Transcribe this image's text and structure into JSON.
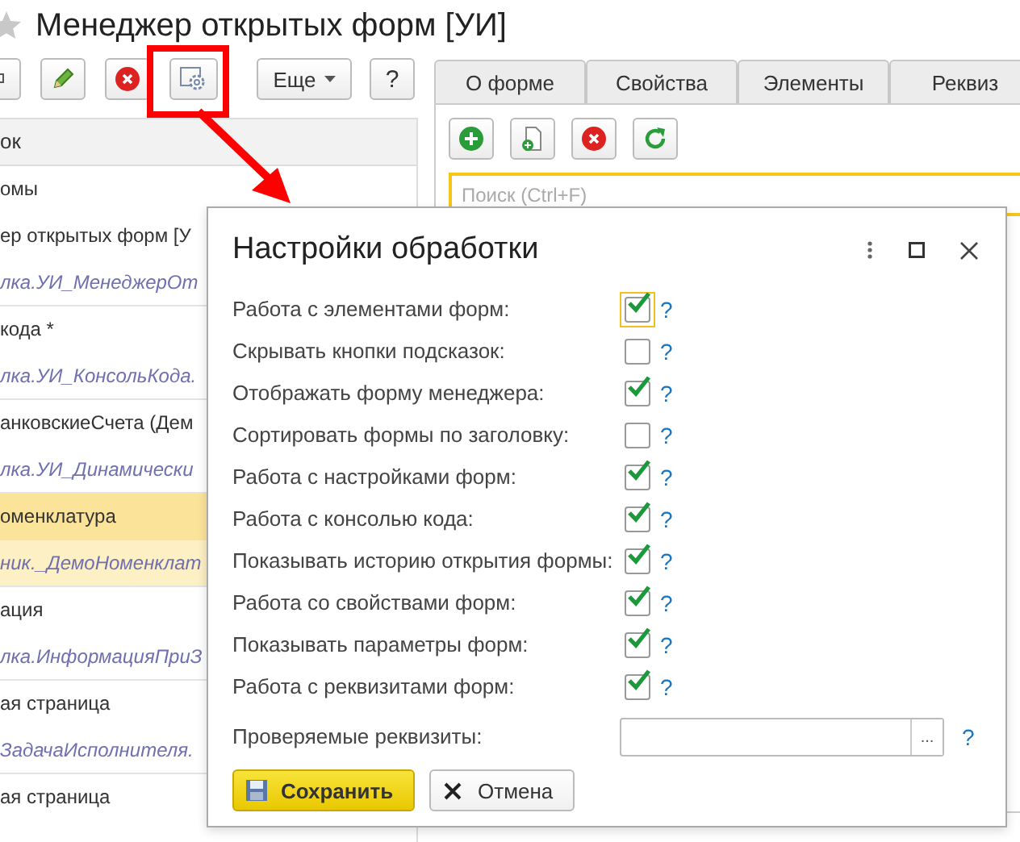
{
  "window": {
    "title": "Менеджер открытых форм [УИ]"
  },
  "toolbar": {
    "more_button": "Еще",
    "help_button": "?"
  },
  "list": {
    "header": "ок",
    "items": [
      {
        "title": "омы",
        "selected": false
      },
      {
        "title": "ер открытых форм [У",
        "path": "лка.УИ_МенеджерОт",
        "selected": false
      },
      {
        "title": "кода *",
        "path": "лка.УИ_КонсольКода.",
        "selected": false
      },
      {
        "title": "анковскиеСчета (Дем",
        "path": "лка.УИ_Динамически",
        "selected": false
      },
      {
        "title": "оменклатура",
        "path": "ник._ДемоНоменклат",
        "selected": true
      },
      {
        "title": "ация",
        "path": "лка.ИнформацияПриЗ",
        "selected": false
      },
      {
        "title": "ая страница",
        "path": "ЗадачаИсполнителя.",
        "selected": false
      },
      {
        "title": "ая страница",
        "selected": false
      }
    ]
  },
  "tabs": [
    {
      "label": "О форме",
      "selected": false
    },
    {
      "label": "Свойства",
      "selected": false
    },
    {
      "label": "Элементы",
      "selected": false
    },
    {
      "label": "Реквиз",
      "selected": false
    }
  ],
  "search": {
    "placeholder": "Поиск (Ctrl+F)"
  },
  "dialog": {
    "title": "Настройки обработки",
    "settings": [
      {
        "label": "Работа с элементами форм:",
        "checked": true,
        "focused": true,
        "help": "?"
      },
      {
        "label": "Скрывать кнопки подсказок:",
        "checked": false,
        "focused": false,
        "help": "?"
      },
      {
        "label": "Отображать форму менеджера:",
        "checked": true,
        "focused": false,
        "help": "?"
      },
      {
        "label": "Сортировать формы по заголовку:",
        "checked": false,
        "focused": false,
        "help": "?"
      },
      {
        "label": "Работа с настройками форм:",
        "checked": true,
        "focused": false,
        "help": "?"
      },
      {
        "label": "Работа с консолью кода:",
        "checked": true,
        "focused": false,
        "help": "?"
      },
      {
        "label": "Показывать историю открытия формы:",
        "checked": true,
        "focused": false,
        "help": "?"
      },
      {
        "label": "Работа со свойствами форм:",
        "checked": true,
        "focused": false,
        "help": "?"
      },
      {
        "label": "Показывать параметры форм:",
        "checked": true,
        "focused": false,
        "help": "?"
      },
      {
        "label": "Работа с реквизитами форм:",
        "checked": true,
        "focused": false,
        "help": "?"
      }
    ],
    "field": {
      "label": "Проверяемые реквизиты:",
      "choice_button": "...",
      "help": "?"
    },
    "save_button": "Сохранить",
    "cancel_button": "Отмена"
  }
}
